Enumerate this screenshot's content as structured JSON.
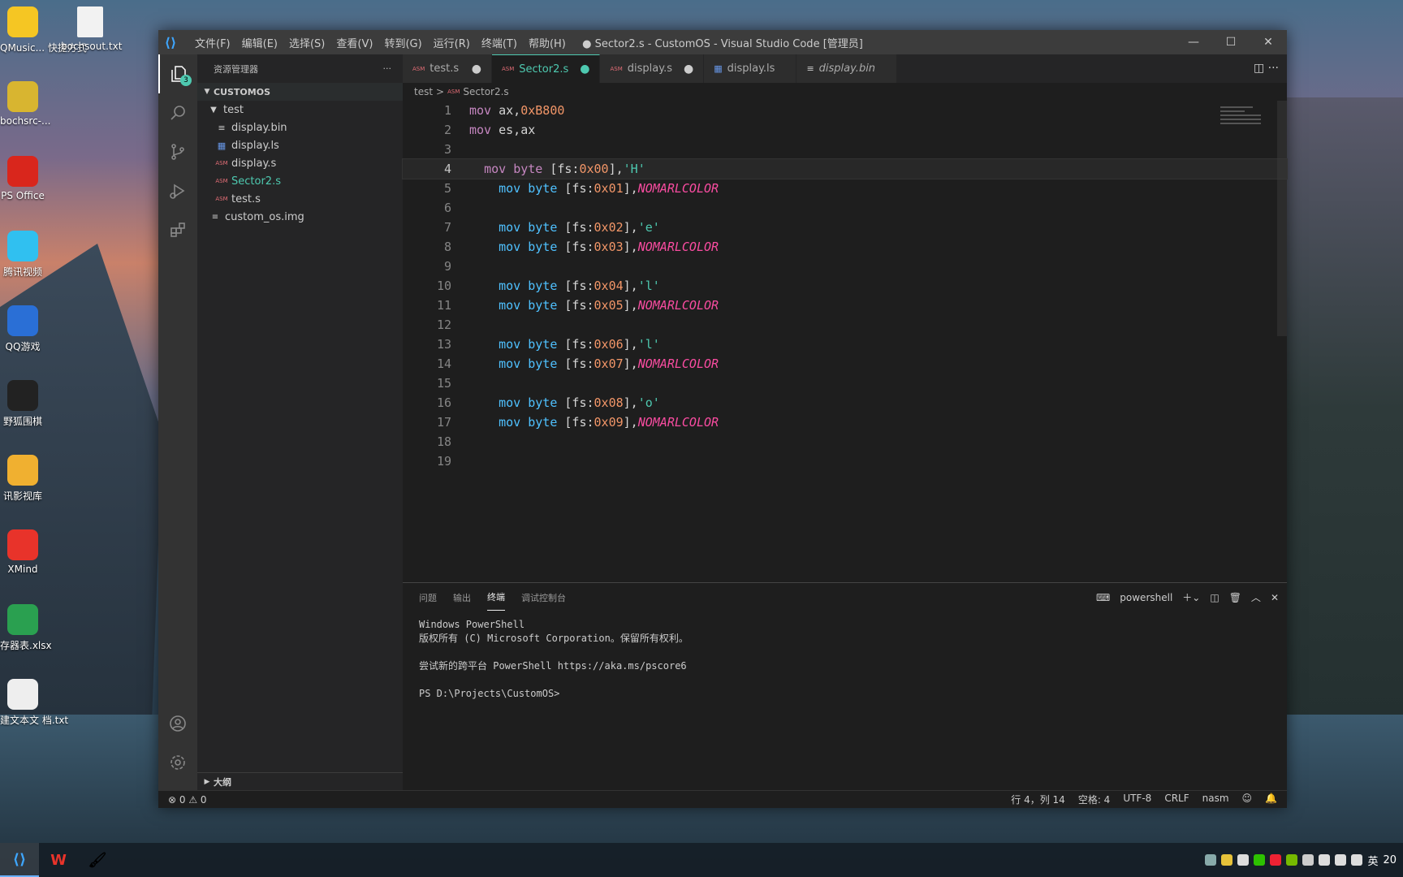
{
  "desktop": {
    "icons": [
      {
        "label": "QMusic... 快捷方式",
        "color": "#f5c623"
      },
      {
        "label": "bochsrc-...",
        "color": "#d8b530"
      },
      {
        "label": "PS Office",
        "color": "#d9261c"
      },
      {
        "label": "腾讯视频",
        "color": "#30c0f0"
      },
      {
        "label": "QQ游戏",
        "color": "#2a6fd6"
      },
      {
        "label": "野狐围棋",
        "color": "#222222"
      },
      {
        "label": "讯影视库",
        "color": "#f0b030"
      },
      {
        "label": "XMind",
        "color": "#e8332a"
      },
      {
        "label": "存器表.xlsx",
        "color": "#2aa050"
      },
      {
        "label": "建文本文 档.txt",
        "color": "#eeeeee"
      }
    ],
    "file_icon_label": "bochsout.txt"
  },
  "window": {
    "logo": "⟨⟩",
    "menu": [
      "文件(F)",
      "编辑(E)",
      "选择(S)",
      "查看(V)",
      "转到(G)",
      "运行(R)",
      "终端(T)",
      "帮助(H)"
    ],
    "title": "● Sector2.s - CustomOS - Visual Studio Code [管理员]",
    "controls": {
      "minimize": "—",
      "maximize": "☐",
      "close": "✕"
    }
  },
  "activity": {
    "explorer_badge": "3"
  },
  "sidebar": {
    "header": "资源管理器",
    "more": "···",
    "section": "CUSTOMOS",
    "folder": "test",
    "files": [
      {
        "name": "display.bin",
        "icon": "≡"
      },
      {
        "name": "display.ls",
        "icon": "▦"
      },
      {
        "name": "display.s",
        "icon": "ASM"
      },
      {
        "name": "Sector2.s",
        "icon": "ASM"
      },
      {
        "name": "test.s",
        "icon": "ASM"
      }
    ],
    "root_file": "custom_os.img",
    "outline": "大纲"
  },
  "tabs": [
    {
      "name": "test.s",
      "icon": "ASM",
      "dirty": "●"
    },
    {
      "name": "Sector2.s",
      "icon": "ASM",
      "dirty": "●"
    },
    {
      "name": "display.s",
      "icon": "ASM",
      "dirty": "●"
    },
    {
      "name": "display.ls",
      "icon": "▦",
      "dirty": ""
    },
    {
      "name": "display.bin",
      "icon": "≡",
      "dirty": ""
    }
  ],
  "tab_actions": "◫  ···",
  "breadcrumb": {
    "folder": "test",
    "sep": ">",
    "file": "Sector2.s"
  },
  "code": {
    "line_numbers": [
      "1",
      "2",
      "3",
      "4",
      "5",
      "6",
      "7",
      "8",
      "9",
      "10",
      "11",
      "12",
      "13",
      "14",
      "15",
      "16",
      "17",
      "18",
      "19"
    ],
    "current_line": 4
  },
  "panel": {
    "tabs": [
      "问题",
      "输出",
      "终端",
      "调试控制台"
    ],
    "shell": "powershell",
    "terminal": [
      "Windows PowerShell",
      "版权所有 (C) Microsoft Corporation。保留所有权利。",
      "",
      "尝试新的跨平台 PowerShell https://aka.ms/pscore6",
      "",
      "PS D:\\Projects\\CustomOS>"
    ]
  },
  "status": {
    "errors": "⊗ 0 ⚠ 0",
    "position": "行 4，列 14",
    "spaces": "空格: 4",
    "encoding": "UTF-8",
    "eol": "CRLF",
    "language": "nasm"
  },
  "taskbar": {
    "apps": [
      "⟨⟩",
      "W",
      "🖌"
    ],
    "ime": "英",
    "clock": "20"
  },
  "colors": {
    "accent": "#4ec9b0",
    "keyword": "#4fc1ff",
    "number": "#f29668",
    "constant": "#f84ca0"
  }
}
